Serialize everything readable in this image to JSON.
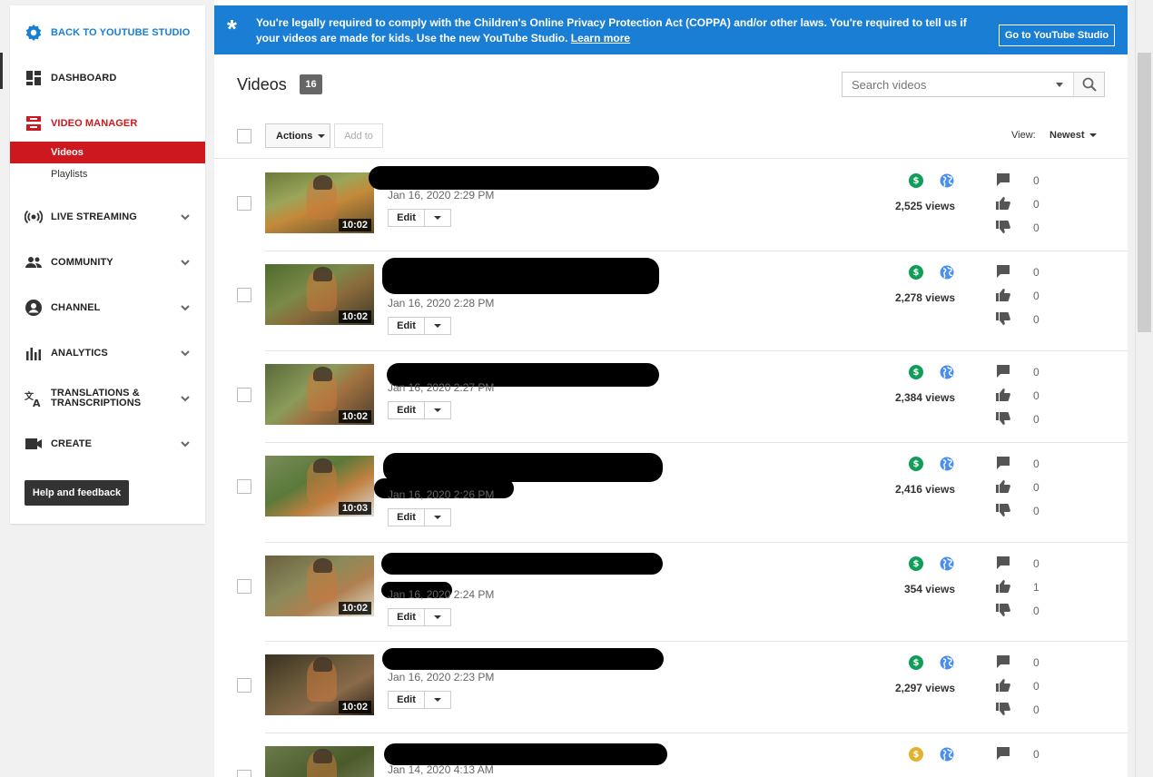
{
  "sidebar": {
    "back": {
      "label": "BACK TO YOUTUBE STUDIO",
      "icon": "gear-icon",
      "color": "#1a7fd4"
    },
    "items": [
      {
        "label": "DASHBOARD",
        "icon": "dashboard-icon"
      },
      {
        "label": "VIDEO MANAGER",
        "icon": "video-manager-icon",
        "color": "#cc181e"
      },
      {
        "label": "LIVE STREAMING",
        "icon": "live-streaming-icon"
      },
      {
        "label": "COMMUNITY",
        "icon": "community-icon"
      },
      {
        "label": "CHANNEL",
        "icon": "channel-icon"
      },
      {
        "label": "ANALYTICS",
        "icon": "analytics-icon"
      },
      {
        "label": "TRANSLATIONS &\nTRANSCRIPTIONS",
        "icon": "translate-icon"
      },
      {
        "label": "CREATE",
        "icon": "create-icon"
      }
    ],
    "subitems": [
      {
        "label": "Videos",
        "active": true
      },
      {
        "label": "Playlists",
        "active": false
      }
    ],
    "help_label": "Help and feedback"
  },
  "banner": {
    "message": "You're legally required to comply with the Children's Online Privacy Protection Act (COPPA) and/or other laws. You're required to tell us if your videos are made for kids. Use the new YouTube Studio.",
    "link": "Learn more",
    "button": "Go to YouTube Studio",
    "color": "#1a7fd4"
  },
  "header": {
    "title": "Videos",
    "count": "16",
    "search_placeholder": "Search videos"
  },
  "toolbar": {
    "actions_label": "Actions",
    "addto_label": "Add to",
    "view_label": "View:",
    "view_value": "Newest"
  },
  "videos": [
    {
      "date": "Jan 16, 2020 2:29 PM",
      "duration": "10:02",
      "views": "2,525 views",
      "comments": "0",
      "likes": "0",
      "dislikes": "0",
      "monetization": "green"
    },
    {
      "date": "Jan 16, 2020 2:28 PM",
      "duration": "10:02",
      "views": "2,278 views",
      "comments": "0",
      "likes": "0",
      "dislikes": "0",
      "monetization": "green"
    },
    {
      "date": "Jan 16, 2020 2:27 PM",
      "duration": "10:02",
      "views": "2,384 views",
      "comments": "0",
      "likes": "0",
      "dislikes": "0",
      "monetization": "green"
    },
    {
      "date": "Jan 16, 2020 2:26 PM",
      "duration": "10:03",
      "views": "2,416 views",
      "comments": "0",
      "likes": "0",
      "dislikes": "0",
      "monetization": "green"
    },
    {
      "date": "Jan 16, 2020 2:24 PM",
      "duration": "10:02",
      "views": "354 views",
      "comments": "0",
      "likes": "1",
      "dislikes": "0",
      "monetization": "green"
    },
    {
      "date": "Jan 16, 2020 2:23 PM",
      "duration": "10:02",
      "views": "2,297 views",
      "comments": "0",
      "likes": "0",
      "dislikes": "0",
      "monetization": "green"
    },
    {
      "date": "Jan 14, 2020 4:13 AM",
      "duration": "",
      "views": "",
      "comments": "0",
      "likes": "",
      "dislikes": "",
      "monetization": "yellow"
    }
  ],
  "labels": {
    "edit": "Edit"
  },
  "colors": {
    "money_green": "#0f9d58",
    "money_yellow": "#e3b12b",
    "globe_blue": "#4a8ff0",
    "icon_gray": "#555555",
    "active_red": "#cc181e"
  }
}
